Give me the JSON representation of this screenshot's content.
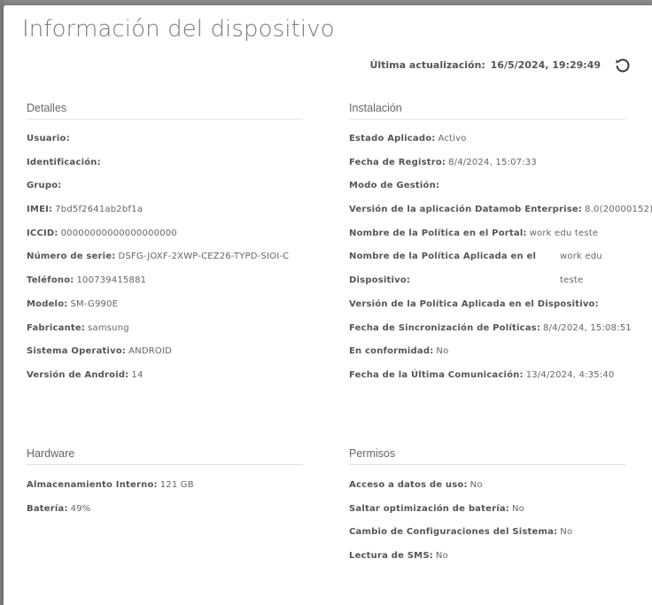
{
  "dialog": {
    "title": "Información del dispositivo",
    "last_update_label": "Última actualización:",
    "last_update_value": "16/5/2024, 19:29:49"
  },
  "detalles": {
    "heading": "Detalles",
    "rows": [
      {
        "label": "Usuario:",
        "value": ""
      },
      {
        "label": "Identificación:",
        "value": ""
      },
      {
        "label": "Grupo:",
        "value": ""
      },
      {
        "label": "IMEI:",
        "value": "7bd5f2641ab2bf1a"
      },
      {
        "label": "ICCID:",
        "value": "00000000000000000000"
      },
      {
        "label": "Número de serie:",
        "value": "DSFG-JOXF-2XWP-CEZ26-TYPD-SIOI-C"
      },
      {
        "label": "Teléfono:",
        "value": "100739415881"
      },
      {
        "label": "Modelo:",
        "value": "SM-G990E"
      },
      {
        "label": "Fabricante:",
        "value": "samsung"
      },
      {
        "label": "Sistema Operativo:",
        "value": "ANDROID"
      },
      {
        "label": "Versión de Android:",
        "value": "14"
      }
    ]
  },
  "instalacion": {
    "heading": "Instalación",
    "rows": [
      {
        "label": "Estado Aplicado:",
        "value": "Activo"
      },
      {
        "label": "Fecha de Registro:",
        "value": "8/4/2024, 15:07:33"
      },
      {
        "label": "Modo de Gestión:",
        "value": ""
      },
      {
        "label": "Versión de la aplicación Datamob Enterprise:",
        "value": "8.0(20000152)"
      },
      {
        "label": "Nombre de la Política en el Portal:",
        "value": "work edu teste"
      }
    ],
    "split_row": {
      "label_line1": "Nombre de la Política Aplicada en el",
      "label_line2": "Dispositivo:",
      "value_line1": "work edu",
      "value_line2": "teste"
    },
    "rows_after": [
      {
        "label": "Versión de la Política Aplicada en el Dispositivo:",
        "value": ""
      },
      {
        "label": "Fecha de Sincronización de Políticas:",
        "value": "8/4/2024, 15:08:51"
      },
      {
        "label": "En conformidad:",
        "value": "No"
      },
      {
        "label": "Fecha de la Última Comunicación:",
        "value": "13/4/2024, 4:35:40"
      }
    ]
  },
  "hardware": {
    "heading": "Hardware",
    "rows": [
      {
        "label": "Almacenamiento Interno:",
        "value": "121 GB"
      },
      {
        "label": "Batería:",
        "value": "49%"
      }
    ]
  },
  "permisos": {
    "heading": "Permisos",
    "rows": [
      {
        "label": "Acceso a datos de uso:",
        "value": "No"
      },
      {
        "label": "Saltar optimización de batería:",
        "value": "No"
      },
      {
        "label": "Cambio de Configuraciones del Sistema:",
        "value": "No"
      },
      {
        "label": "Lectura de SMS:",
        "value": "No"
      }
    ]
  },
  "icons": {
    "refresh": "refresh-icon"
  }
}
